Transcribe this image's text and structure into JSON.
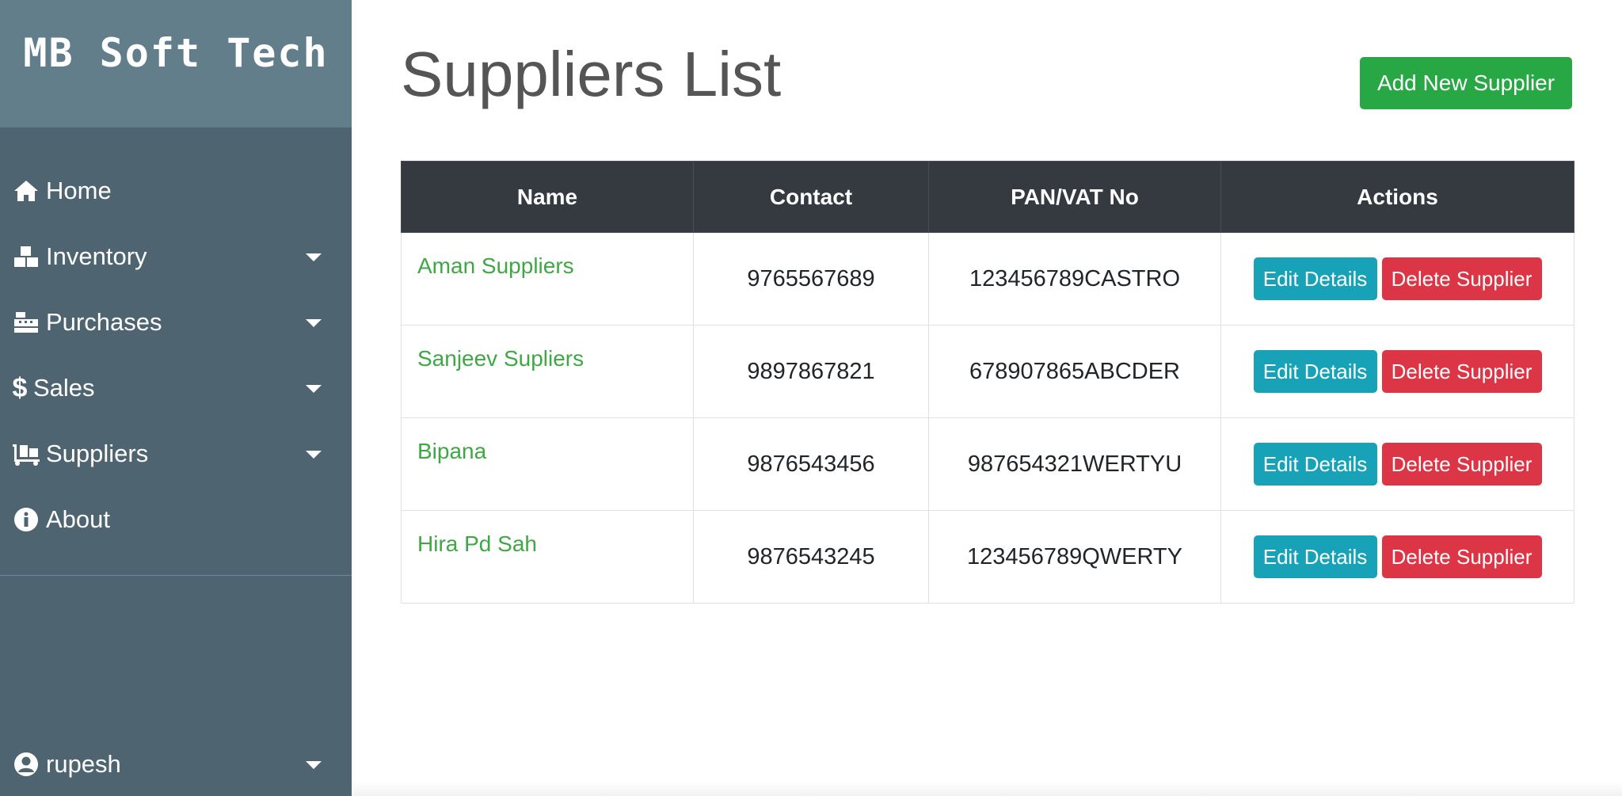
{
  "brand": {
    "title": "MB Soft Tech"
  },
  "sidebar": {
    "items": [
      {
        "label": "Home",
        "icon": "home-icon",
        "has_dropdown": false
      },
      {
        "label": "Inventory",
        "icon": "boxes-icon",
        "has_dropdown": true
      },
      {
        "label": "Purchases",
        "icon": "cash-register-icon",
        "has_dropdown": true
      },
      {
        "label": "Sales",
        "icon": "dollar-icon",
        "has_dropdown": true
      },
      {
        "label": "Suppliers",
        "icon": "dolly-icon",
        "has_dropdown": true
      },
      {
        "label": "About",
        "icon": "info-circle-icon",
        "has_dropdown": false
      }
    ],
    "user": {
      "label": "rupesh",
      "icon": "user-circle-icon"
    }
  },
  "page": {
    "title": "Suppliers List",
    "add_button_label": "Add New Supplier"
  },
  "table": {
    "headers": [
      "Name",
      "Contact",
      "PAN/VAT No",
      "Actions"
    ],
    "rows": [
      {
        "name": "Aman Suppliers",
        "contact": "9765567689",
        "pan": "123456789CASTRO"
      },
      {
        "name": "Sanjeev Supliers",
        "contact": "9897867821",
        "pan": "678907865ABCDER"
      },
      {
        "name": "Bipana",
        "contact": "9876543456",
        "pan": "987654321WERTYU"
      },
      {
        "name": "Hira Pd Sah",
        "contact": "9876543245",
        "pan": "123456789QWERTY"
      }
    ],
    "edit_label": "Edit Details",
    "delete_label": "Delete Supplier"
  },
  "colors": {
    "sidebar_bg": "#4f6471",
    "brand_bg": "#637e8b",
    "table_header_bg": "#343a40",
    "success": "#28a745",
    "info": "#17a2b8",
    "danger": "#dc3545",
    "link_green": "#3fa845"
  }
}
